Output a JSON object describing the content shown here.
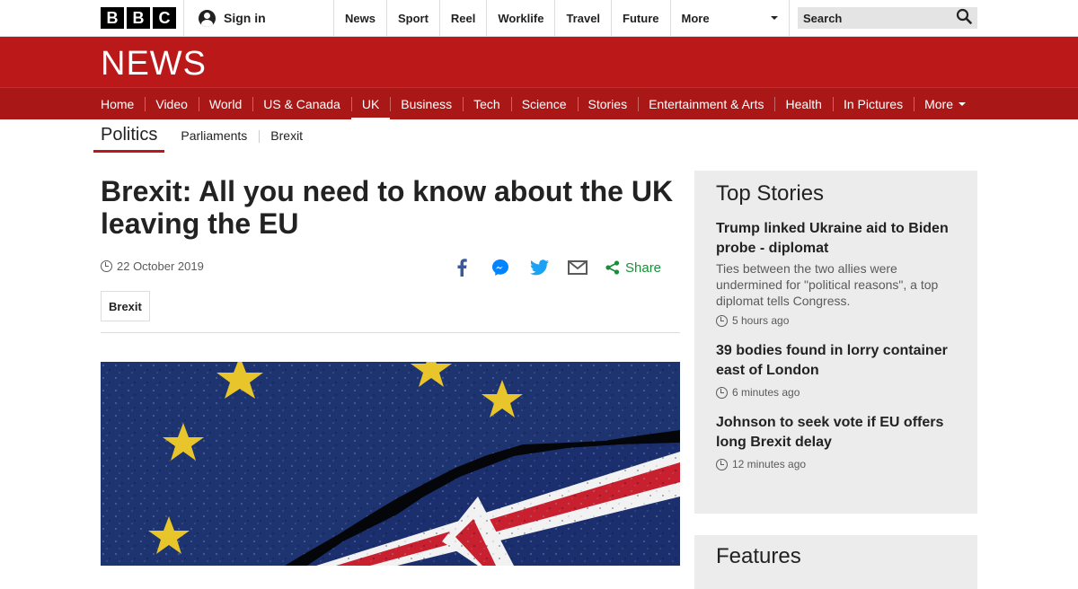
{
  "brand": {
    "bbc_letters": [
      "B",
      "B",
      "C"
    ],
    "news_wordmark": "NEWS"
  },
  "topbar": {
    "signin_label": "Sign in",
    "nav": [
      "News",
      "Sport",
      "Reel",
      "Worklife",
      "Travel",
      "Future"
    ],
    "more_label": "More",
    "search_placeholder": "Search"
  },
  "section_nav": {
    "items": [
      "Home",
      "Video",
      "World",
      "US & Canada",
      "UK",
      "Business",
      "Tech",
      "Science",
      "Stories",
      "Entertainment & Arts",
      "Health",
      "In Pictures"
    ],
    "active": "UK",
    "more_label": "More"
  },
  "sub_nav": {
    "current": "Politics",
    "links": [
      "Parliaments",
      "Brexit"
    ]
  },
  "article": {
    "headline": "Brexit: All you need to know about the UK leaving the EU",
    "date": "22 October 2019",
    "share_label": "Share",
    "share_icons": [
      "facebook-icon",
      "messenger-icon",
      "twitter-icon",
      "email-icon",
      "share-icon"
    ],
    "tag": "Brexit"
  },
  "top_stories": {
    "heading": "Top Stories",
    "items": [
      {
        "title": "Trump linked Ukraine aid to Biden probe - diplomat",
        "summary": "Ties between the two allies were undermined for \"political reasons\", a top diplomat tells Congress.",
        "time": "5 hours ago"
      },
      {
        "title": "39 bodies found in lorry container east of London",
        "summary": "",
        "time": "6 minutes ago"
      },
      {
        "title": "Johnson to seek vote if EU offers long Brexit delay",
        "summary": "",
        "time": "12 minutes ago"
      }
    ]
  },
  "features": {
    "heading": "Features"
  },
  "colors": {
    "brand_red": "#bb1919",
    "nav_red": "#a91717",
    "share_green": "#1a8f3b",
    "panel_grey": "#ececec"
  }
}
